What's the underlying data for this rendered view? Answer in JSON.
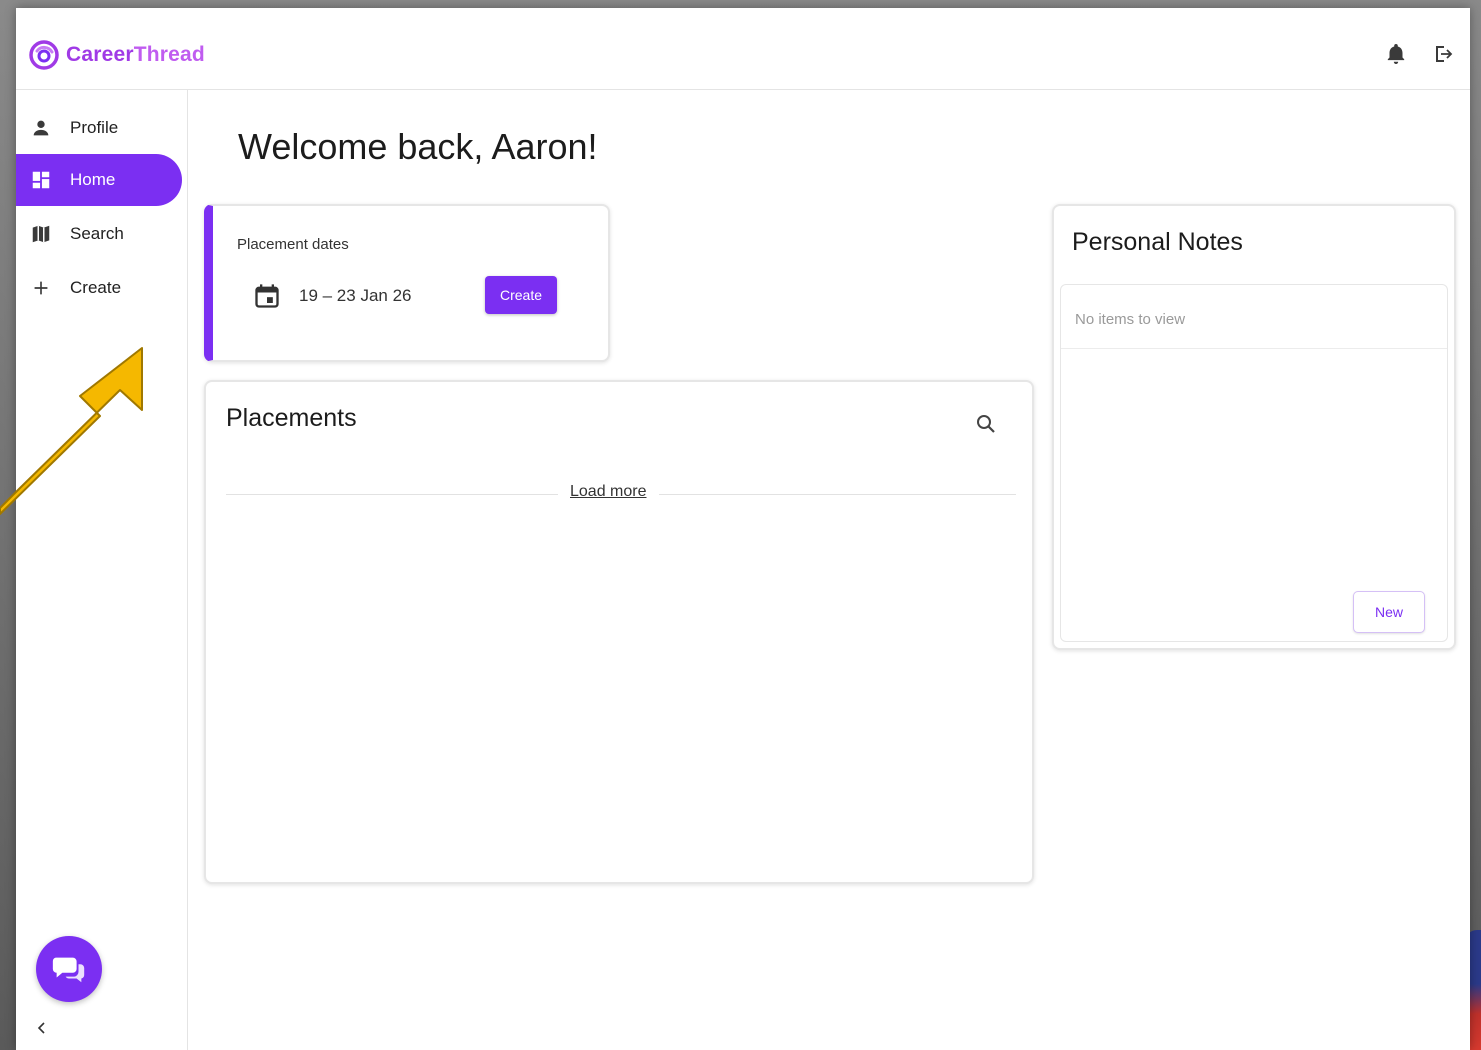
{
  "brand": {
    "name_part1": "Career",
    "name_part2": "Thread"
  },
  "header": {
    "notifications_icon": "bell-icon",
    "logout_icon": "logout-icon"
  },
  "sidebar": {
    "items": [
      {
        "label": "Profile",
        "icon": "person-icon",
        "active": false
      },
      {
        "label": "Home",
        "icon": "dashboard-icon",
        "active": true
      },
      {
        "label": "Search",
        "icon": "map-icon",
        "active": false
      },
      {
        "label": "Create",
        "icon": "plus-icon",
        "active": false
      }
    ],
    "chat_icon": "chat-icon",
    "collapse_icon": "chevron-left-icon"
  },
  "main": {
    "welcome": "Welcome back, Aaron!",
    "placement_dates": {
      "label": "Placement dates",
      "range": "19 – 23 Jan 26",
      "create_label": "Create"
    },
    "placements": {
      "title": "Placements",
      "load_more": "Load more"
    },
    "notes": {
      "title": "Personal Notes",
      "empty": "No items to view",
      "new_label": "New"
    }
  },
  "colors": {
    "accent": "#7b2ff2",
    "brand": "#a03ae6",
    "annotation_arrow": "#f5b800"
  }
}
